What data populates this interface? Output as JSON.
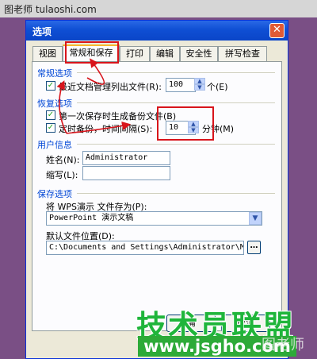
{
  "watermark": {
    "top": "图老师 tulaoshi.com",
    "brand": "技术员联盟",
    "url": "www.jsgho.com",
    "corner": "图老师"
  },
  "dialog": {
    "title": "选项",
    "tabs": [
      "视图",
      "常规和保存",
      "打印",
      "编辑",
      "安全性",
      "拼写检查"
    ],
    "general": {
      "heading": "常规选项",
      "recent_label": "最近文档管理列出文件(R):",
      "recent_value": "100",
      "recent_unit": "个(E)"
    },
    "recovery": {
      "heading": "恢复选项",
      "first_backup_label": "第一次保存时生成备份文件(B)",
      "timed_backup_label": "定时备份，时间间隔(S):",
      "interval_value": "10",
      "interval_unit": "分钟(M)"
    },
    "user": {
      "heading": "用户信息",
      "name_label": "姓名(N):",
      "name_value": "Administrator",
      "initials_label": "缩写(L):",
      "initials_value": ""
    },
    "save": {
      "heading": "保存选项",
      "format_label": "将 WPS演示 文件存为(P):",
      "format_value": "PowerPoint 演示文稿",
      "location_label": "默认文件位置(D):",
      "location_value": "C:\\Documents and Settings\\Administrator\\My Doc",
      "browse_label": "…"
    },
    "buttons": {
      "ok": "确",
      "cancel": "取消"
    }
  }
}
